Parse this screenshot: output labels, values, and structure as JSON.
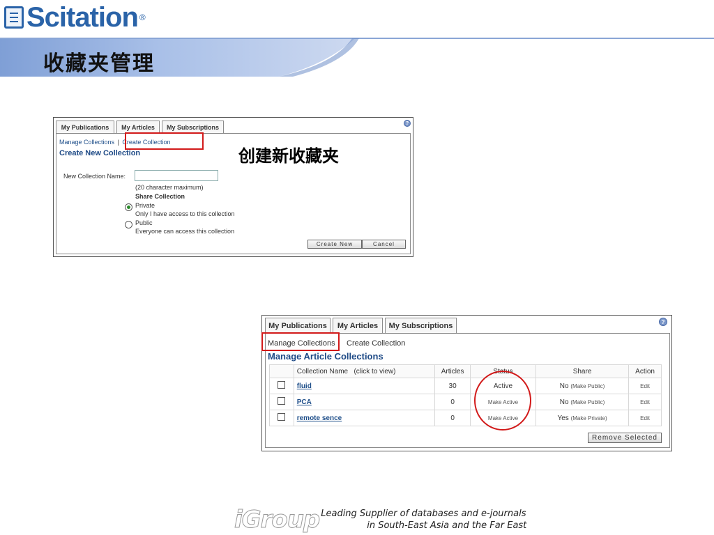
{
  "logo": {
    "text": "Scitation",
    "reg": "®"
  },
  "slide_title": "收藏夹管理",
  "top_panel": {
    "tabs": [
      "My Publications",
      "My Articles",
      "My Subscriptions"
    ],
    "help_icon": "?",
    "nav_manage": "Manage Collections",
    "nav_sep": "|",
    "nav_create": "Create Collection",
    "heading": "Create New Collection",
    "name_label": "New Collection Name:",
    "name_value": "",
    "max_hint": "(20 character maximum)",
    "share_label": "Share Collection",
    "private_label": "Private",
    "private_desc": "Only I have access to this collection",
    "public_label": "Public",
    "public_desc": "Everyone can access this collection",
    "create_btn": "Create New",
    "cancel_btn": "Cancel"
  },
  "annotation": "创建新收藏夹",
  "bottom_panel": {
    "tabs": [
      "My Publications",
      "My Articles",
      "My Subscriptions"
    ],
    "help_icon": "?",
    "nav_manage": "Manage Collections",
    "nav_create": "Create Collection",
    "heading": "Manage Article Collections",
    "columns": [
      "Collection Name",
      "(click to view)",
      "Articles",
      "Status",
      "Share",
      "Action"
    ],
    "rows": [
      {
        "name": "fluid",
        "articles": "30",
        "status": "Active",
        "share": "No",
        "share_link": "(Make Public)",
        "action": "Edit"
      },
      {
        "name": "PCA",
        "articles": "0",
        "status": "Make Active",
        "share": "No",
        "share_link": "(Make Public)",
        "action": "Edit"
      },
      {
        "name": "remote sence",
        "articles": "0",
        "status": "Make Active",
        "share": "Yes",
        "share_link": "(Make Private)",
        "action": "Edit"
      }
    ],
    "remove_btn": "Remove Selected"
  },
  "footer": {
    "brand": "iGroup",
    "line1": "Leading Supplier of databases and e-journals",
    "line2": "in South-East Asia and the Far East"
  },
  "colors": {
    "brand_blue": "#2a63a8",
    "link_blue": "#1f4f8a",
    "highlight_red": "#d21a1a"
  }
}
